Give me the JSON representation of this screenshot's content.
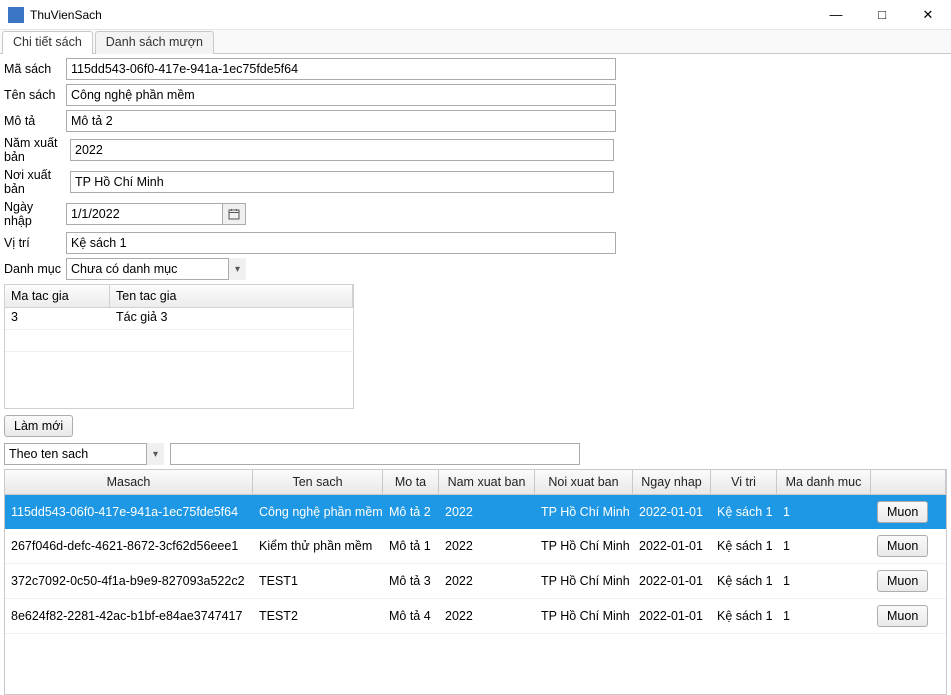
{
  "window": {
    "title": "ThuVienSach"
  },
  "tabs": {
    "t0": "Chi tiết sách",
    "t1": "Danh sách mượn"
  },
  "form": {
    "masach_label": "Mã sách",
    "masach": "115dd543-06f0-417e-941a-1ec75fde5f64",
    "tensach_label": "Tên sách",
    "tensach": "Công nghệ phần mềm",
    "mota_label": "Mô tả",
    "mota": "Mô tả 2",
    "namxb_label": "Năm xuất bản",
    "namxb": "2022",
    "noixb_label": "Nơi xuất bản",
    "noixb": "TP Hồ Chí Minh",
    "ngaynhap_label": "Ngày nhập",
    "ngaynhap": "1/1/2022",
    "vitri_label": "Vị trí",
    "vitri": "Kệ sách 1",
    "danhmuc_label": "Danh mục",
    "danhmuc": "Chưa có danh mục"
  },
  "author_grid": {
    "h1": "Ma tac gia",
    "h2": "Ten tac gia",
    "rows": [
      {
        "matg": "3",
        "tentg": "Tác giả 3"
      }
    ]
  },
  "lammoi_btn": "Làm mới",
  "search": {
    "mode": "Theo ten sach",
    "value": ""
  },
  "grid": {
    "headers": {
      "masach": "Masach",
      "tensach": "Ten sach",
      "mota": "Mo ta",
      "nxb": "Nam xuat ban",
      "noi": "Noi xuat ban",
      "ngay": "Ngay nhap",
      "vitri": "Vi tri",
      "madm": "Ma danh muc"
    },
    "btn_label": "Muon",
    "rows": [
      {
        "masach": "115dd543-06f0-417e-941a-1ec75fde5f64",
        "tensach": "Công nghệ phần mềm",
        "mota": "Mô tả 2",
        "nxb": "2022",
        "noi": "TP Hồ Chí Minh",
        "ngay": "2022-01-01",
        "vitri": "Kệ sách 1",
        "madm": "1",
        "selected": true
      },
      {
        "masach": "267f046d-defc-4621-8672-3cf62d56eee1",
        "tensach": "Kiểm thử phần mềm",
        "mota": "Mô tả 1",
        "nxb": "2022",
        "noi": "TP Hồ Chí Minh",
        "ngay": "2022-01-01",
        "vitri": "Kệ sách 1",
        "madm": "1",
        "selected": false
      },
      {
        "masach": "372c7092-0c50-4f1a-b9e9-827093a522c2",
        "tensach": "TEST1",
        "mota": "Mô tả 3",
        "nxb": "2022",
        "noi": "TP Hồ Chí Minh",
        "ngay": "2022-01-01",
        "vitri": "Kệ sách 1",
        "madm": "1",
        "selected": false
      },
      {
        "masach": "8e624f82-2281-42ac-b1bf-e84ae3747417",
        "tensach": "TEST2",
        "mota": "Mô tả 4",
        "nxb": "2022",
        "noi": "TP Hồ Chí Minh",
        "ngay": "2022-01-01",
        "vitri": "Kệ sách 1",
        "madm": "1",
        "selected": false
      }
    ]
  }
}
